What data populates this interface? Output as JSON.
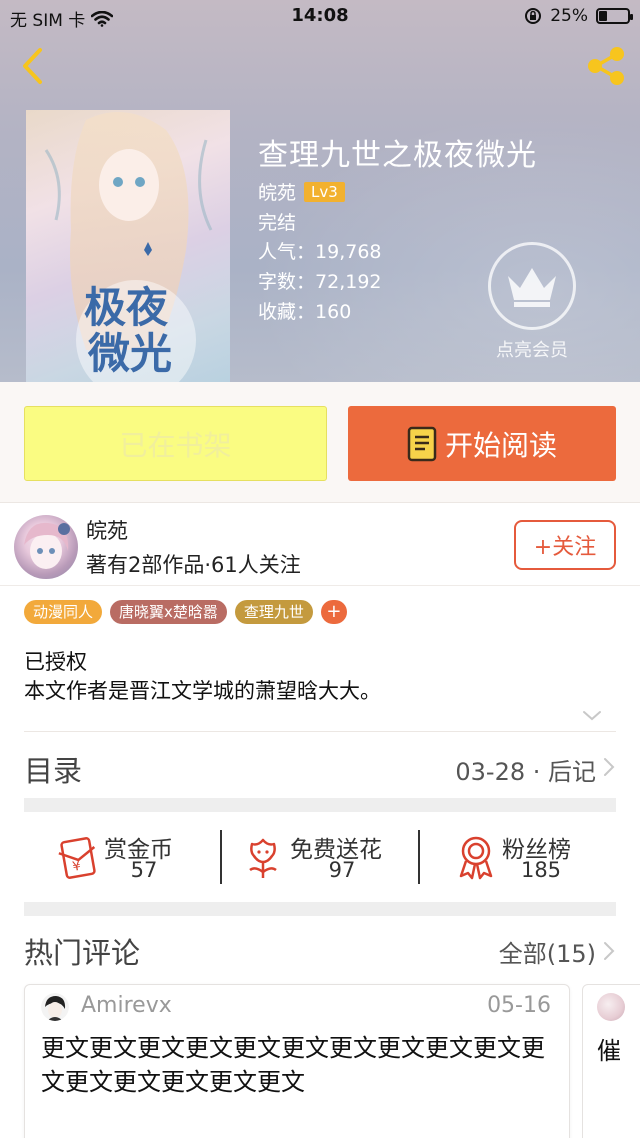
{
  "status_bar": {
    "carrier": "无 SIM 卡",
    "time": "14:08",
    "battery": "25%"
  },
  "book": {
    "title": "查理九世之极夜微光",
    "author": "皖苑",
    "level": "Lv3",
    "status": "完结",
    "popularity_label": "人气：",
    "popularity": "19,768",
    "wordcount_label": "字数：",
    "wordcount": "72,192",
    "favorites_label": "收藏：",
    "favorites": "160",
    "cover_text": "极夜微光"
  },
  "vip": {
    "label": "点亮会员"
  },
  "actions": {
    "shelf_label": "已在书架",
    "read_label": "开始阅读"
  },
  "author": {
    "name": "皖苑",
    "stats": "著有2部作品·61人关注",
    "follow_label": "+关注"
  },
  "tags": [
    {
      "label": "动漫同人",
      "color": "#f2a93b"
    },
    {
      "label": "唐晓翼x楚晗嚣",
      "color": "#b96c63"
    },
    {
      "label": "查理九世",
      "color": "#c49a3e"
    }
  ],
  "tag_plus": "+",
  "description": {
    "line1": "已授权",
    "line2": "本文作者是晋江文学城的萧望晗大大。"
  },
  "toc": {
    "title": "目录",
    "latest": "03-28 · 后记"
  },
  "stats": [
    {
      "label": "赏金币",
      "value": "57",
      "icon": "red-envelope-yen-icon"
    },
    {
      "label": "免费送花",
      "value": "97",
      "icon": "flower-icon"
    },
    {
      "label": "粉丝榜",
      "value": "185",
      "icon": "rosette-badge-icon"
    }
  ],
  "comments": {
    "title": "热门评论",
    "all_label": "全部(15)",
    "items": [
      {
        "user": "Amirevx",
        "date": "05-16",
        "text": "更文更文更文更文更文更文更文更文更文更文更文更文更文更文更文更文"
      },
      {
        "text": "催"
      }
    ]
  },
  "colors": {
    "accent": "#ec6a3d",
    "shelf_button": "#fafc82",
    "follow": "#e55a3c",
    "icon_red": "#d9412e",
    "share_yellow": "#f7c51e"
  }
}
